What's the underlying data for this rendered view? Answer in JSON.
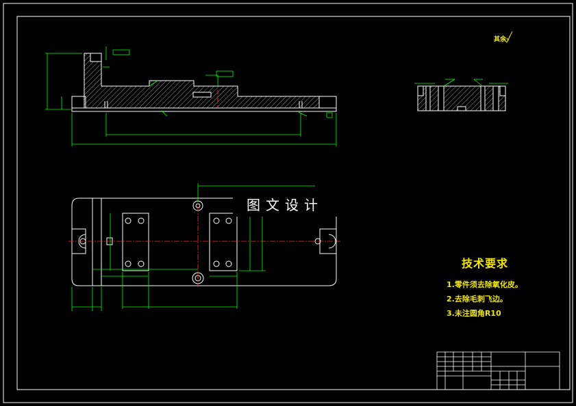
{
  "watermark": "图文设计",
  "roughness": "其余√",
  "notes": {
    "title": "技术要求",
    "items": [
      "1.零件须去除氧化皮。",
      "2.去除毛刺飞边。",
      "3.未注圆角R10"
    ]
  },
  "colors": {
    "background": "#000000",
    "outline": "#ffffff",
    "dimension": "#00ff00",
    "hatch": "#9a9a9a",
    "centerline": "#ff2a2a",
    "notes": "#f2e600"
  }
}
